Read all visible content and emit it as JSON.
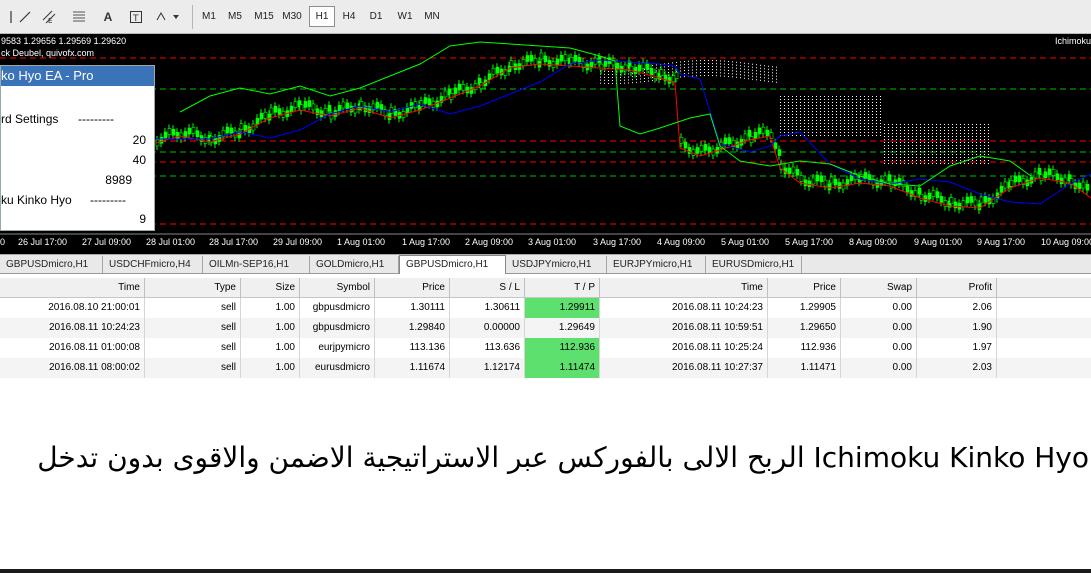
{
  "toolbar": {
    "icons": [
      "line-tool-icon",
      "crosshair-icon",
      "channel-icon",
      "fibonacci-icon",
      "grid-icon",
      "text-icon",
      "text-label-icon",
      "arrows-icon"
    ],
    "timeframes": [
      "M1",
      "M5",
      "M15",
      "M30",
      "H1",
      "H4",
      "D1",
      "W1",
      "MN"
    ],
    "active_timeframe": "H1",
    "text_tool": "A"
  },
  "chart": {
    "ohlc_text": "9583 1.29656 1.29569 1.29620",
    "broker_text": "ck Deubel, quivofx.com",
    "indicator_label": "Ichimoku",
    "time_axis": [
      "0",
      "26 Jul 17:00",
      "27 Jul 09:00",
      "28 Jul 01:00",
      "28 Jul 17:00",
      "29 Jul 09:00",
      "1 Aug 01:00",
      "1 Aug 17:00",
      "2 Aug 09:00",
      "3 Aug 01:00",
      "3 Aug 17:00",
      "4 Aug 09:00",
      "5 Aug 01:00",
      "5 Aug 17:00",
      "8 Aug 09:00",
      "9 Aug 01:00",
      "9 Aug 17:00",
      "10 Aug 09:00"
    ],
    "colors": {
      "background": "#000000",
      "candle": "#00ff00",
      "tenkan": "#ff0000",
      "kijun": "#0000ff",
      "chikou": "#00ff00",
      "kumo": "#ffffff",
      "levels": "#ff0000"
    }
  },
  "ea_panel": {
    "title": "ko Hyo EA - Pro",
    "settings_label": "rd Settings",
    "settings_dashes": "---------",
    "value1": "20",
    "value2": "40",
    "value3": "8989",
    "ichimoku_label": "ku Kinko Hyo",
    "ichimoku_dashes": "---------",
    "value4": "9"
  },
  "tabs": [
    {
      "label": "GBPUSDmicro,H1",
      "active": false
    },
    {
      "label": "USDCHFmicro,H4",
      "active": false
    },
    {
      "label": "OILMn-SEP16,H1",
      "active": false
    },
    {
      "label": "GOLDmicro,H1",
      "active": false
    },
    {
      "label": "GBPUSDmicro,H1",
      "active": true
    },
    {
      "label": "USDJPYmicro,H1",
      "active": false
    },
    {
      "label": "EURJPYmicro,H1",
      "active": false
    },
    {
      "label": "EURUSDmicro,H1",
      "active": false
    }
  ],
  "table": {
    "headers": [
      "Time",
      "Type",
      "Size",
      "Symbol",
      "Price",
      "S / L",
      "T / P",
      "Time",
      "Price",
      "Swap",
      "Profit"
    ],
    "rows": [
      {
        "open_time": "2016.08.10 21:00:01",
        "type": "sell",
        "size": "1.00",
        "symbol": "gbpusdmicro",
        "price": "1.30111",
        "sl": "1.30611",
        "tp": "1.29911",
        "tp_hit": true,
        "close_time": "2016.08.11 10:24:23",
        "close_price": "1.29905",
        "swap": "0.00",
        "profit": "2.06"
      },
      {
        "open_time": "2016.08.11 10:24:23",
        "type": "sell",
        "size": "1.00",
        "symbol": "gbpusdmicro",
        "price": "1.29840",
        "sl": "0.00000",
        "tp": "1.29649",
        "tp_hit": false,
        "close_time": "2016.08.11 10:59:51",
        "close_price": "1.29650",
        "swap": "0.00",
        "profit": "1.90"
      },
      {
        "open_time": "2016.08.11 01:00:08",
        "type": "sell",
        "size": "1.00",
        "symbol": "eurjpymicro",
        "price": "113.136",
        "sl": "113.636",
        "tp": "112.936",
        "tp_hit": true,
        "close_time": "2016.08.11 10:25:24",
        "close_price": "112.936",
        "swap": "0.00",
        "profit": "1.97"
      },
      {
        "open_time": "2016.08.11 08:00:02",
        "type": "sell",
        "size": "1.00",
        "symbol": "eurusdmicro",
        "price": "1.11674",
        "sl": "1.12174",
        "tp": "1.11474",
        "tp_hit": true,
        "close_time": "2016.08.11 10:27:37",
        "close_price": "1.11471",
        "swap": "0.00",
        "profit": "2.03"
      }
    ],
    "tp_hit_color": "#5ee06e"
  },
  "caption": {
    "text": "Ichimoku Kinko Hyo الربح الالى بالفوركس عبر الاستراتيجية الاضمن والاقوى بدون تدخل"
  }
}
